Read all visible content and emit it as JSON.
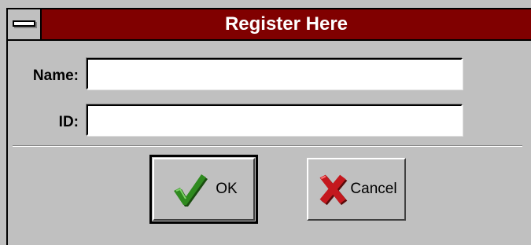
{
  "dialog": {
    "title": "Register Here"
  },
  "form": {
    "name_label": "Name:",
    "name_value": "",
    "id_label": "ID:",
    "id_value": ""
  },
  "buttons": {
    "ok_label": "OK",
    "cancel_label": "Cancel"
  },
  "icons": {
    "ok_icon": "check-icon",
    "cancel_icon": "x-icon",
    "system_menu": "system-menu-icon"
  },
  "colors": {
    "titlebar": "#800000",
    "check": "#2f8a1f",
    "x": "#c4181e"
  }
}
